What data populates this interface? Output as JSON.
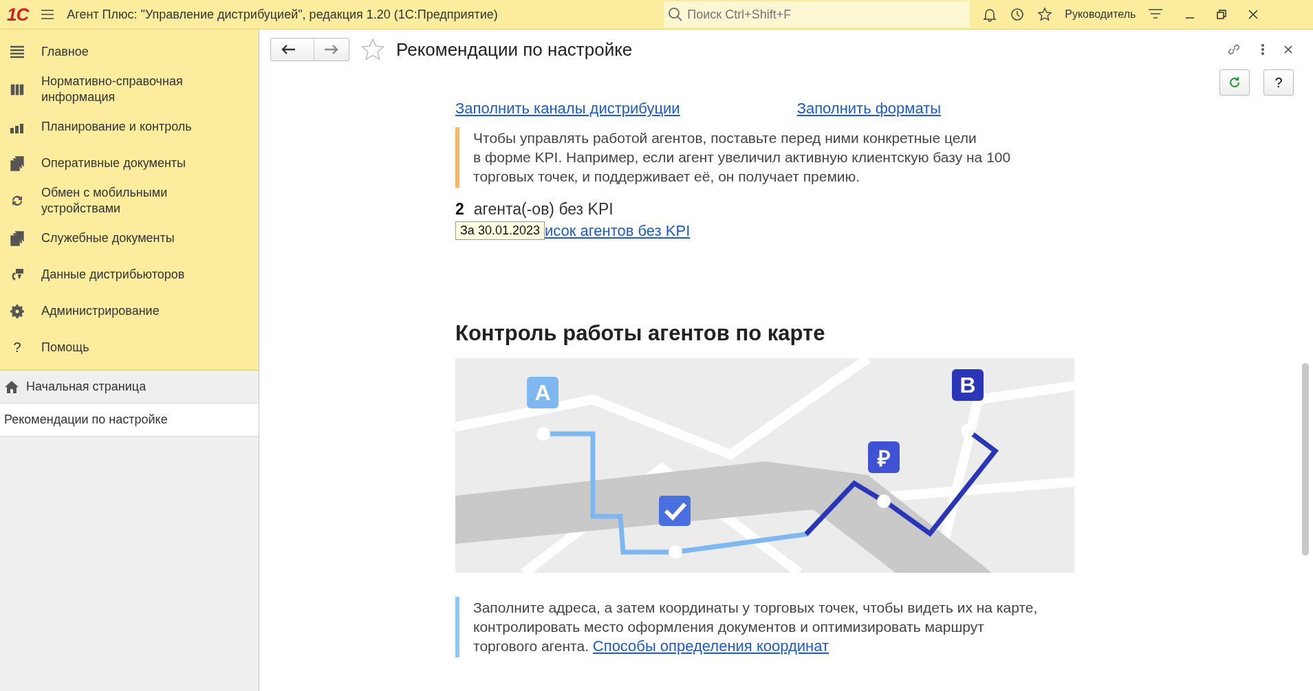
{
  "window": {
    "title": "Агент Плюс: \"Управление дистрибуцией\", редакция 1.20  (1С:Предприятие)",
    "logo": "1С",
    "search": {
      "placeholder": "Поиск Ctrl+Shift+F"
    },
    "user": "Руководитель"
  },
  "sidebar": {
    "items": [
      {
        "label": "Главное"
      },
      {
        "label": "Нормативно-справочная информация"
      },
      {
        "label": "Планирование и контроль"
      },
      {
        "label": "Оперативные документы"
      },
      {
        "label": "Обмен с мобильными устройствами"
      },
      {
        "label": "Служебные документы"
      },
      {
        "label": "Данные дистрибьюторов"
      },
      {
        "label": "Администрирование"
      },
      {
        "label": "Помощь",
        "icon_char": "?"
      }
    ],
    "open_windows": [
      {
        "label": "Начальная страница",
        "selected": false
      },
      {
        "label": "Рекомендации по настройке",
        "selected": true
      }
    ]
  },
  "form": {
    "title": "Рекомендации по настройке",
    "help": "?",
    "top_links": [
      "Заполнить каналы дистрибуции",
      "Заполнить форматы"
    ],
    "kpi_note": {
      "color": "#f7b56a",
      "lines": [
        "Чтобы управлять работой агентов, поставьте перед ними конкретные цели",
        "в форме KPI. Например, если агент увеличил активную клиентскую базу на 100 торговых точек, и поддерживает её, он получает премию."
      ]
    },
    "count": "2",
    "count_label": "агента(-ов) без KPI",
    "tooltip": "За 30.01.2023",
    "link": "исок агентов без KPI",
    "section_title": "Контроль работы агентов по карте",
    "map_pins": [
      {
        "label": "A",
        "color": "#7fb8f0"
      },
      {
        "label": "B",
        "color": "#2b35b8"
      },
      {
        "label": "₽",
        "color": "#3f52d6"
      }
    ],
    "map_note": {
      "color": "#8ec8f5",
      "text": "Заполните адреса, а затем координаты у торговых точек, чтобы видеть их на карте, контролировать место оформления документов и оптимизировать маршрут торгового агента.",
      "link": "Способы определения координат"
    }
  }
}
